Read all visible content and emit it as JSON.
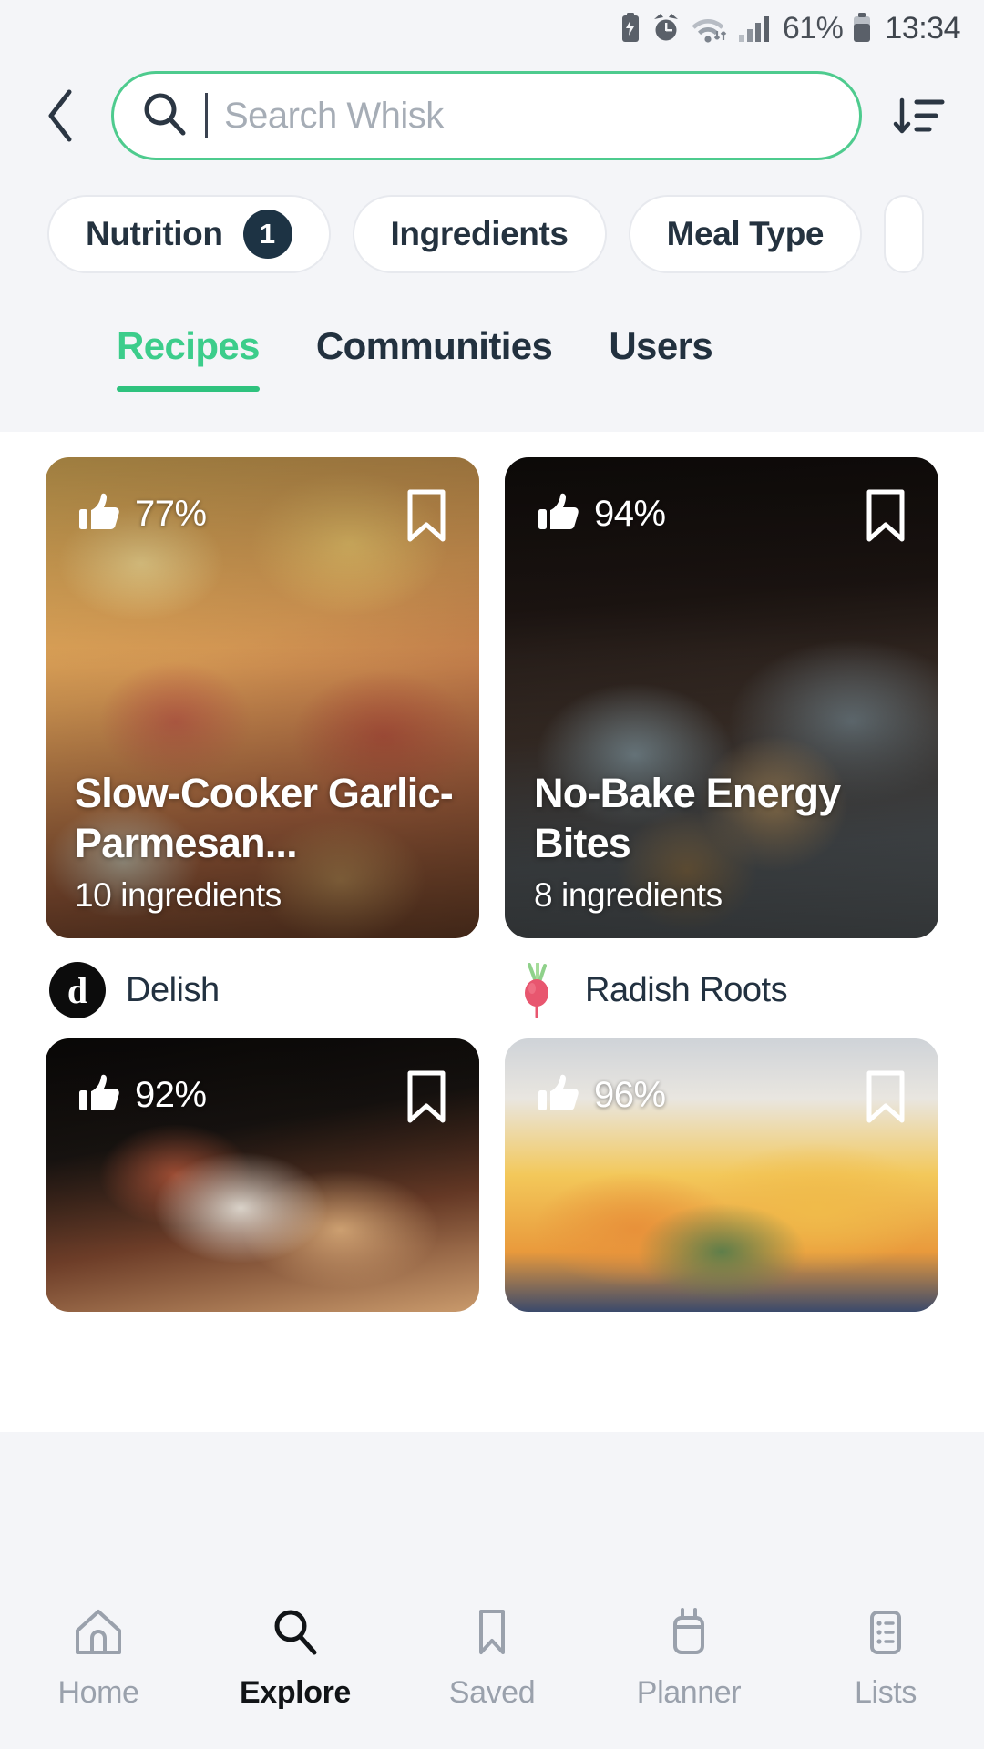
{
  "statusbar": {
    "icons": [
      "battery-saver-icon",
      "alarm-icon",
      "wifi-icon",
      "signal-icon"
    ],
    "battery_percent": "61%",
    "time": "13:34"
  },
  "header": {
    "back_icon": "chevron-left-icon",
    "search": {
      "placeholder": "Search Whisk",
      "value": "",
      "icon": "search-icon"
    },
    "sort_icon": "sort-descending-icon"
  },
  "filters": [
    {
      "label": "Nutrition",
      "badge": "1"
    },
    {
      "label": "Ingredients",
      "badge": ""
    },
    {
      "label": "Meal Type",
      "badge": ""
    }
  ],
  "tabs": [
    {
      "label": "Recipes",
      "active": true
    },
    {
      "label": "Communities",
      "active": false
    },
    {
      "label": "Users",
      "active": false
    }
  ],
  "recipes": [
    {
      "rating": "77%",
      "title": "Slow-Cooker Garlic-Parmesan...",
      "ingredients": "10 ingredients",
      "author": "Delish",
      "author_avatar": "d",
      "bookmark_icon": "bookmark-icon",
      "like_icon": "thumbs-up-icon"
    },
    {
      "rating": "94%",
      "title": "No-Bake Energy Bites",
      "ingredients": "8 ingredients",
      "author": "Radish Roots",
      "author_avatar": "radish-icon",
      "bookmark_icon": "bookmark-icon",
      "like_icon": "thumbs-up-icon"
    },
    {
      "rating": "92%",
      "title": "",
      "ingredients": "",
      "author": "",
      "bookmark_icon": "bookmark-icon",
      "like_icon": "thumbs-up-icon"
    },
    {
      "rating": "96%",
      "title": "",
      "ingredients": "",
      "author": "",
      "bookmark_icon": "bookmark-icon",
      "like_icon": "thumbs-up-icon"
    }
  ],
  "bottomnav": [
    {
      "label": "Home",
      "icon": "home-icon",
      "active": false
    },
    {
      "label": "Explore",
      "icon": "search-icon",
      "active": true
    },
    {
      "label": "Saved",
      "icon": "bookmark-icon",
      "active": false
    },
    {
      "label": "Planner",
      "icon": "calendar-icon",
      "active": false
    },
    {
      "label": "Lists",
      "icon": "list-icon",
      "active": false
    }
  ],
  "colors": {
    "accent_green": "#2ec27e",
    "tab_active": "#3ccd8b",
    "navy": "#1d3344",
    "page_bg": "#f4f5f8"
  }
}
